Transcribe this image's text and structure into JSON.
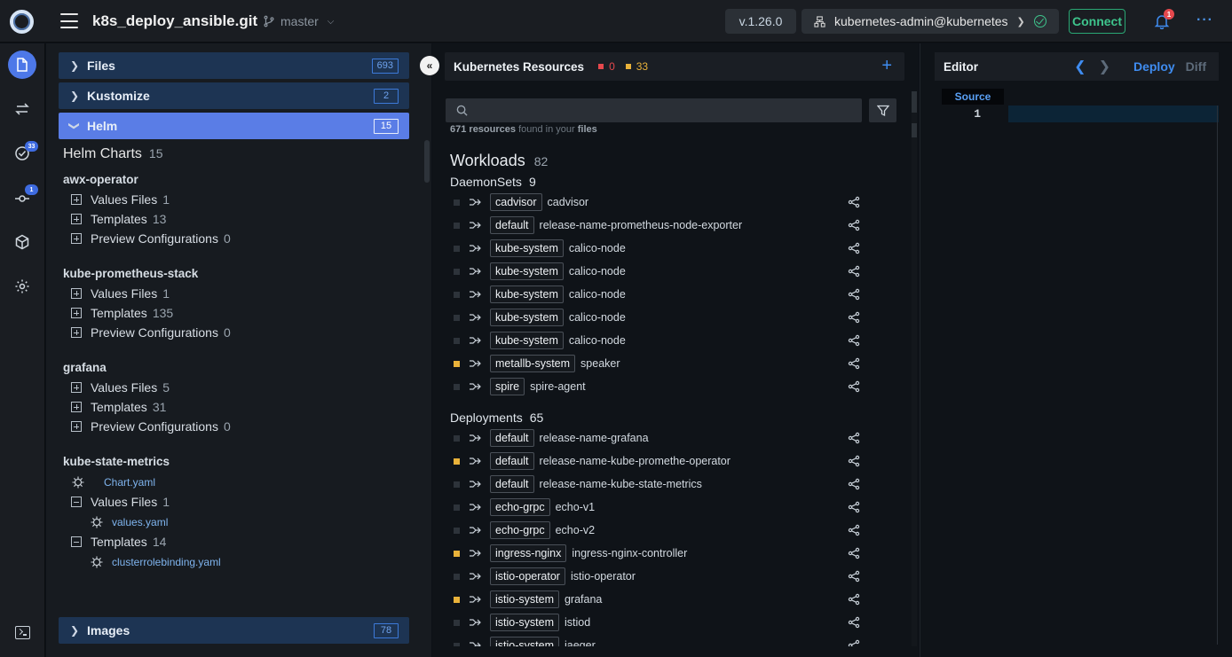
{
  "header": {
    "repo_title": "k8s_deploy_ansible.git",
    "branch": "master",
    "version": "v.1.26.0",
    "cluster": "kubernetes-admin@kubernetes",
    "connect_label": "Connect",
    "notification_count": "1",
    "more_label": "···"
  },
  "rail": {
    "validation_badge": "33",
    "git_badge": "1"
  },
  "explorer": {
    "sections": {
      "files": {
        "label": "Files",
        "count": "693"
      },
      "kustomize": {
        "label": "Kustomize",
        "count": "2"
      },
      "helm": {
        "label": "Helm",
        "count": "15"
      },
      "images": {
        "label": "Images",
        "count": "78"
      }
    },
    "helm_charts_title": "Helm Charts",
    "helm_charts_count": "15",
    "charts": [
      {
        "name": "awx-operator",
        "rows": [
          {
            "label": "Values Files",
            "count": "1"
          },
          {
            "label": "Templates",
            "count": "13"
          },
          {
            "label": "Preview Configurations",
            "count": "0"
          }
        ]
      },
      {
        "name": "kube-prometheus-stack",
        "rows": [
          {
            "label": "Values Files",
            "count": "1"
          },
          {
            "label": "Templates",
            "count": "135"
          },
          {
            "label": "Preview Configurations",
            "count": "0"
          }
        ]
      },
      {
        "name": "grafana",
        "rows": [
          {
            "label": "Values Files",
            "count": "5"
          },
          {
            "label": "Templates",
            "count": "31"
          },
          {
            "label": "Preview Configurations",
            "count": "0"
          }
        ]
      },
      {
        "name": "kube-state-metrics",
        "chart_file": "Chart.yaml",
        "values_label": "Values Files",
        "values_count": "1",
        "values_file": "values.yaml",
        "templates_label": "Templates",
        "templates_count": "14",
        "template_file": "clusterrolebinding.yaml"
      }
    ]
  },
  "navigator": {
    "title": "Kubernetes Resources",
    "error_count": "0",
    "warning_count": "33",
    "search_placeholder": "",
    "found_count": "671 resources",
    "found_mid": "found in your",
    "found_end": "files",
    "workloads_title": "Workloads",
    "workloads_count": "82",
    "daemonsets_title": "DaemonSets",
    "daemonsets_count": "9",
    "daemonsets": [
      {
        "ns": "cadvisor",
        "name": "cadvisor",
        "warn": false
      },
      {
        "ns": "default",
        "name": "release-name-prometheus-node-exporter",
        "warn": false
      },
      {
        "ns": "kube-system",
        "name": "calico-node",
        "warn": false
      },
      {
        "ns": "kube-system",
        "name": "calico-node",
        "warn": false
      },
      {
        "ns": "kube-system",
        "name": "calico-node",
        "warn": false
      },
      {
        "ns": "kube-system",
        "name": "calico-node",
        "warn": false
      },
      {
        "ns": "kube-system",
        "name": "calico-node",
        "warn": false
      },
      {
        "ns": "metallb-system",
        "name": "speaker",
        "warn": true
      },
      {
        "ns": "spire",
        "name": "spire-agent",
        "warn": false
      }
    ],
    "deployments_title": "Deployments",
    "deployments_count": "65",
    "deployments": [
      {
        "ns": "default",
        "name": "release-name-grafana",
        "warn": false
      },
      {
        "ns": "default",
        "name": "release-name-kube-promethe-operator",
        "warn": true
      },
      {
        "ns": "default",
        "name": "release-name-kube-state-metrics",
        "warn": false
      },
      {
        "ns": "echo-grpc",
        "name": "echo-v1",
        "warn": false
      },
      {
        "ns": "echo-grpc",
        "name": "echo-v2",
        "warn": false
      },
      {
        "ns": "ingress-nginx",
        "name": "ingress-nginx-controller",
        "warn": true
      },
      {
        "ns": "istio-operator",
        "name": "istio-operator",
        "warn": false
      },
      {
        "ns": "istio-system",
        "name": "grafana",
        "warn": true
      },
      {
        "ns": "istio-system",
        "name": "istiod",
        "warn": false
      },
      {
        "ns": "istio-system",
        "name": "jaeger",
        "warn": false
      }
    ]
  },
  "editor": {
    "title": "Editor",
    "deploy_label": "Deploy",
    "diff_label": "Diff",
    "source_tab": "Source",
    "line_number": "1"
  },
  "colors": {
    "accent": "#4d78e8",
    "warning": "#e9b23a",
    "error": "#e5484d",
    "success": "#3ec48c"
  }
}
